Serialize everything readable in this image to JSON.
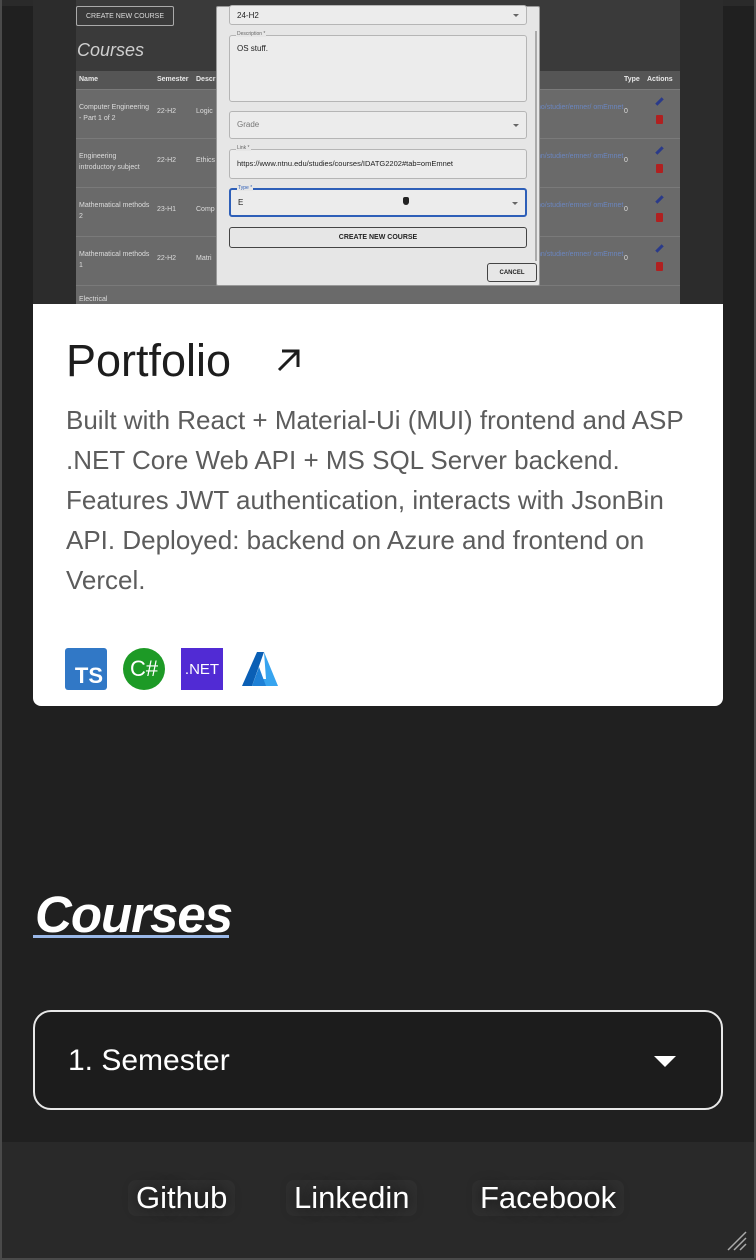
{
  "project": {
    "title": "Portfolio",
    "description": "Built with React + Material-Ui (MUI) frontend and ASP .NET Core Web API + MS SQL Server backend. Features JWT authentication, interacts with JsonBin API. Deployed: backend on Azure and frontend on Vercel.",
    "link_icon": "arrow-up-right-icon",
    "tech_icons": [
      "typescript-icon",
      "csharp-icon",
      "dotnet-icon",
      "azure-icon"
    ],
    "tech_labels": {
      "ts": "TS",
      "cs": "C#",
      "net": ".NET"
    },
    "screenshot": {
      "create_button": "CREATE NEW COURSE",
      "heading": "Courses",
      "table_headers": [
        "Name",
        "Semester",
        "Descr",
        "Type",
        "Actions"
      ],
      "rows": [
        {
          "name": "Computer Engineering - Part 1 of 2",
          "semester": "22-H2",
          "desc": "Logic",
          "link": "no/studier/emner/ omEmnet",
          "type": "0"
        },
        {
          "name": "Engineering introductory subject",
          "semester": "22-H2",
          "desc": "Ethics Pytho",
          "link": "nn/studier/emner/ omEmnet",
          "type": "0"
        },
        {
          "name": "Mathematical methods 2",
          "semester": "23-H1",
          "desc": "Comp differ",
          "link": "no/studier/emner/ omEmnet",
          "type": "0"
        },
        {
          "name": "Mathematical methods 1",
          "semester": "22-H2",
          "desc": "Matri",
          "link": "nn/studier/emner/ omEmnet",
          "type": "0"
        },
        {
          "name": "Electrical",
          "semester": "",
          "desc": "",
          "link": "",
          "type": ""
        }
      ],
      "dialog": {
        "semester_value": "24-H2",
        "description_label": "Description *",
        "description_value": "OS stuff.",
        "grade_placeholder": "Grade",
        "link_label": "Link *",
        "link_value": "https://www.ntnu.edu/studies/courses/IDATG2202#tab=omEmnet",
        "type_label": "Type *",
        "type_value": "E",
        "create_button": "CREATE NEW COURSE",
        "cancel_button": "CANCEL"
      }
    }
  },
  "courses": {
    "title": "Courses",
    "selected": "1. Semester"
  },
  "footer": {
    "links": [
      "Github",
      "Linkedin",
      "Facebook"
    ]
  },
  "colors": {
    "background": "#202020",
    "card": "#ffffff",
    "accent_underline": "#9ab8e8"
  }
}
